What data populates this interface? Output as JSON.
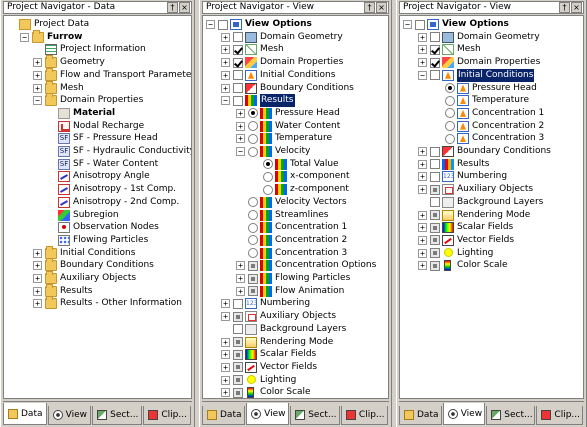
{
  "panels": [
    {
      "id": "data",
      "title": "Project Navigator - Data",
      "tabs": [
        "Data",
        "View",
        "Sect...",
        "Clip..."
      ],
      "active_tab": 0,
      "rows": [
        {
          "label": "Project Data",
          "indent": 0,
          "icon": "pdata",
          "exp": ""
        },
        {
          "label": "Furrow",
          "indent": 1,
          "icon": "folder",
          "exp": "-",
          "bold": true
        },
        {
          "label": "Project Information",
          "indent": 2,
          "icon": "info",
          "exp": ""
        },
        {
          "label": "Geometry",
          "indent": 2,
          "icon": "folder",
          "exp": "+"
        },
        {
          "label": "Flow and Transport Parameters",
          "indent": 2,
          "icon": "folder",
          "exp": "+"
        },
        {
          "label": "Mesh",
          "indent": 2,
          "icon": "folder",
          "exp": "+"
        },
        {
          "label": "Domain Properties",
          "indent": 2,
          "icon": "folder",
          "exp": "-"
        },
        {
          "label": "Material",
          "indent": 3,
          "icon": "mat",
          "exp": "",
          "bold": true
        },
        {
          "label": "Nodal Recharge",
          "indent": 3,
          "icon": "red",
          "exp": ""
        },
        {
          "label": "SF - Pressure Head",
          "indent": 3,
          "icon": "sf",
          "exp": ""
        },
        {
          "label": "SF - Hydraulic Conductivity",
          "indent": 3,
          "icon": "sf",
          "exp": ""
        },
        {
          "label": "SF - Water Content",
          "indent": 3,
          "icon": "sf",
          "exp": ""
        },
        {
          "label": "Anisotropy Angle",
          "indent": 3,
          "icon": "aniso",
          "exp": ""
        },
        {
          "label": "Anisotropy - 1st Comp.",
          "indent": 3,
          "icon": "aniso",
          "exp": ""
        },
        {
          "label": "Anisotropy - 2nd Comp.",
          "indent": 3,
          "icon": "aniso",
          "exp": ""
        },
        {
          "label": "Subregion",
          "indent": 3,
          "icon": "subr",
          "exp": ""
        },
        {
          "label": "Observation Nodes",
          "indent": 3,
          "icon": "obs",
          "exp": ""
        },
        {
          "label": "Flowing Particles",
          "indent": 3,
          "icon": "part",
          "exp": ""
        },
        {
          "label": "Initial Conditions",
          "indent": 2,
          "icon": "folder",
          "exp": "+"
        },
        {
          "label": "Boundary Conditions",
          "indent": 2,
          "icon": "folder",
          "exp": "+"
        },
        {
          "label": "Auxiliary Objects",
          "indent": 2,
          "icon": "folder",
          "exp": "+"
        },
        {
          "label": "Results",
          "indent": 2,
          "icon": "folder",
          "exp": "+"
        },
        {
          "label": "Results - Other Information",
          "indent": 2,
          "icon": "folder",
          "exp": "+"
        }
      ]
    },
    {
      "id": "view1",
      "title": "Project Navigator - View",
      "tabs": [
        "Data",
        "View",
        "Sect...",
        "Clip..."
      ],
      "active_tab": 1,
      "rows": [
        {
          "label": "View Options",
          "indent": 0,
          "icon": "viewopt",
          "exp": "-",
          "ctl": "cb",
          "bold": true
        },
        {
          "label": "Domain Geometry",
          "indent": 1,
          "icon": "domgeo",
          "exp": "+",
          "ctl": "cb"
        },
        {
          "label": "Mesh",
          "indent": 1,
          "icon": "mesh",
          "exp": "+",
          "ctl": "cb-on"
        },
        {
          "label": "Domain Properties",
          "indent": 1,
          "icon": "dprop",
          "exp": "+",
          "ctl": "cb-on"
        },
        {
          "label": "Initial Conditions",
          "indent": 1,
          "icon": "initc",
          "exp": "+",
          "ctl": "cb"
        },
        {
          "label": "Boundary Conditions",
          "indent": 1,
          "icon": "bndc",
          "exp": "+",
          "ctl": "cb"
        },
        {
          "label": "Results",
          "indent": 1,
          "icon": "bars",
          "exp": "-",
          "ctl": "cb",
          "sel": true
        },
        {
          "label": "Pressure Head",
          "indent": 2,
          "icon": "bars",
          "exp": "+",
          "ctl": "rad-on"
        },
        {
          "label": "Water Content",
          "indent": 2,
          "icon": "bars",
          "exp": "+",
          "ctl": "rad"
        },
        {
          "label": "Temperature",
          "indent": 2,
          "icon": "bars",
          "exp": "+",
          "ctl": "rad"
        },
        {
          "label": "Velocity",
          "indent": 2,
          "icon": "bars",
          "exp": "-",
          "ctl": "rad"
        },
        {
          "label": "Total Value",
          "indent": 3,
          "icon": "bars",
          "exp": "",
          "ctl": "rad-on"
        },
        {
          "label": "x-component",
          "indent": 3,
          "icon": "bars",
          "exp": "",
          "ctl": "rad"
        },
        {
          "label": "z-component",
          "indent": 3,
          "icon": "bars",
          "exp": "",
          "ctl": "rad"
        },
        {
          "label": "Velocity Vectors",
          "indent": 2,
          "icon": "bars",
          "exp": "",
          "ctl": "rad"
        },
        {
          "label": "Streamlines",
          "indent": 2,
          "icon": "bars",
          "exp": "",
          "ctl": "rad"
        },
        {
          "label": "Concentration 1",
          "indent": 2,
          "icon": "bars",
          "exp": "",
          "ctl": "rad"
        },
        {
          "label": "Concentration 2",
          "indent": 2,
          "icon": "bars",
          "exp": "",
          "ctl": "rad"
        },
        {
          "label": "Concentration 3",
          "indent": 2,
          "icon": "bars",
          "exp": "",
          "ctl": "rad"
        },
        {
          "label": "Concentration Options",
          "indent": 2,
          "icon": "bars",
          "exp": "+",
          "ctl": "cb-part"
        },
        {
          "label": "Flowing Particles",
          "indent": 2,
          "icon": "bars",
          "exp": "+",
          "ctl": "cb-part"
        },
        {
          "label": "Flow Animation",
          "indent": 2,
          "icon": "bars",
          "exp": "+",
          "ctl": "cb-part"
        },
        {
          "label": "Numbering",
          "indent": 1,
          "icon": "num",
          "exp": "+",
          "ctl": "cb"
        },
        {
          "label": "Auxiliary Objects",
          "indent": 1,
          "icon": "aux",
          "exp": "+",
          "ctl": "cb-part"
        },
        {
          "label": "Background Layers",
          "indent": 1,
          "icon": "bgl",
          "exp": "",
          "ctl": "cb"
        },
        {
          "label": "Rendering Mode",
          "indent": 1,
          "icon": "rend",
          "exp": "+",
          "ctl": "cb-part"
        },
        {
          "label": "Scalar Fields",
          "indent": 1,
          "icon": "scal",
          "exp": "+",
          "ctl": "cb-part"
        },
        {
          "label": "Vector Fields",
          "indent": 1,
          "icon": "vect",
          "exp": "+",
          "ctl": "cb-part"
        },
        {
          "label": "Lighting",
          "indent": 1,
          "icon": "light",
          "exp": "+",
          "ctl": "cb-part"
        },
        {
          "label": "Color Scale",
          "indent": 1,
          "icon": "cscale",
          "exp": "+",
          "ctl": "cb-part"
        }
      ]
    },
    {
      "id": "view2",
      "title": "Project Navigator - View",
      "tabs": [
        "Data",
        "View",
        "Sect...",
        "Clip..."
      ],
      "active_tab": 1,
      "rows": [
        {
          "label": "View Options",
          "indent": 0,
          "icon": "viewopt",
          "exp": "-",
          "ctl": "cb",
          "bold": true
        },
        {
          "label": "Domain Geometry",
          "indent": 1,
          "icon": "domgeo",
          "exp": "+",
          "ctl": "cb"
        },
        {
          "label": "Mesh",
          "indent": 1,
          "icon": "mesh",
          "exp": "+",
          "ctl": "cb-on"
        },
        {
          "label": "Domain Properties",
          "indent": 1,
          "icon": "dprop",
          "exp": "+",
          "ctl": "cb-on"
        },
        {
          "label": "Initial Conditions",
          "indent": 1,
          "icon": "initc",
          "exp": "-",
          "ctl": "cb",
          "sel": true
        },
        {
          "label": "Pressure Head",
          "indent": 2,
          "icon": "initc",
          "exp": "",
          "ctl": "rad-on"
        },
        {
          "label": "Temperature",
          "indent": 2,
          "icon": "initc",
          "exp": "",
          "ctl": "rad"
        },
        {
          "label": "Concentration 1",
          "indent": 2,
          "icon": "initc",
          "exp": "",
          "ctl": "rad"
        },
        {
          "label": "Concentration 2",
          "indent": 2,
          "icon": "initc",
          "exp": "",
          "ctl": "rad"
        },
        {
          "label": "Concentration 3",
          "indent": 2,
          "icon": "initc",
          "exp": "",
          "ctl": "rad"
        },
        {
          "label": "Boundary Conditions",
          "indent": 1,
          "icon": "bndc",
          "exp": "+",
          "ctl": "cb"
        },
        {
          "label": "Results",
          "indent": 1,
          "icon": "bars2",
          "exp": "+",
          "ctl": "cb"
        },
        {
          "label": "Numbering",
          "indent": 1,
          "icon": "num",
          "exp": "+",
          "ctl": "cb"
        },
        {
          "label": "Auxiliary Objects",
          "indent": 1,
          "icon": "aux",
          "exp": "+",
          "ctl": "cb-part"
        },
        {
          "label": "Background Layers",
          "indent": 1,
          "icon": "bgl",
          "exp": "",
          "ctl": "cb"
        },
        {
          "label": "Rendering Mode",
          "indent": 1,
          "icon": "rend",
          "exp": "+",
          "ctl": "cb-part"
        },
        {
          "label": "Scalar Fields",
          "indent": 1,
          "icon": "scal",
          "exp": "+",
          "ctl": "cb-part"
        },
        {
          "label": "Vector Fields",
          "indent": 1,
          "icon": "vect",
          "exp": "+",
          "ctl": "cb-part"
        },
        {
          "label": "Lighting",
          "indent": 1,
          "icon": "light",
          "exp": "+",
          "ctl": "cb-part"
        },
        {
          "label": "Color Scale",
          "indent": 1,
          "icon": "cscale",
          "exp": "+",
          "ctl": "cb-part"
        }
      ]
    }
  ],
  "title_buttons": [
    "pin-icon",
    "close-icon"
  ]
}
